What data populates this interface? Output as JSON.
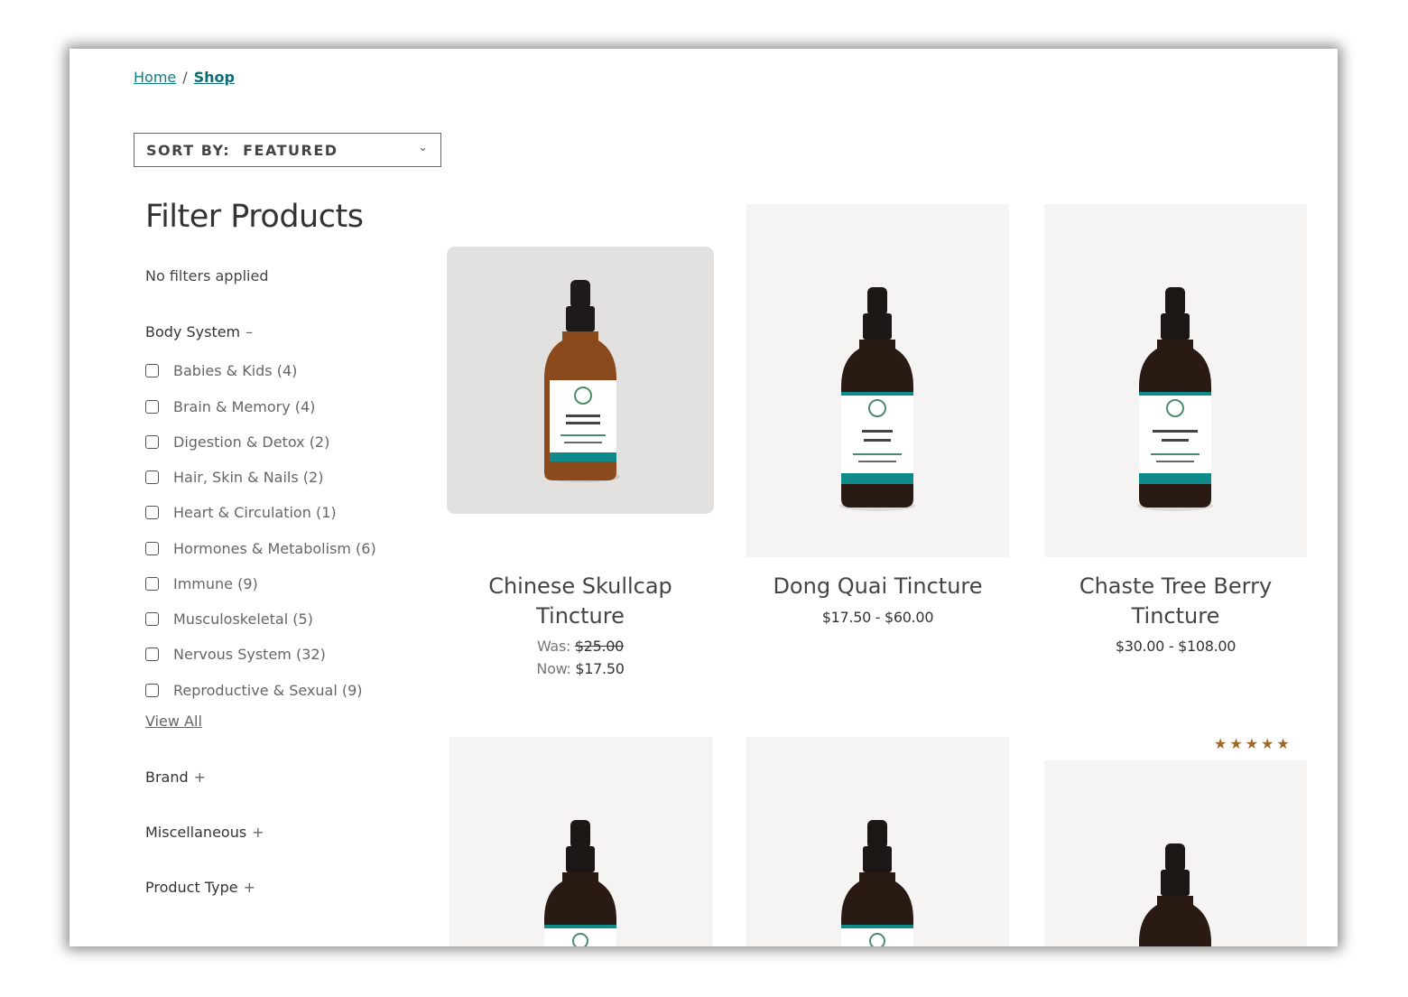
{
  "breadcrumb": {
    "home": "Home",
    "separator": "/",
    "current": "Shop"
  },
  "sort": {
    "label": "SORT BY:",
    "value": "FEATURED"
  },
  "filters": {
    "title": "Filter Products",
    "status": "No filters applied",
    "body_system": {
      "heading": "Body System",
      "toggle": "–",
      "items": [
        "Babies & Kids (4)",
        "Brain & Memory (4)",
        "Digestion & Detox (2)",
        "Hair, Skin & Nails (2)",
        "Heart & Circulation (1)",
        "Hormones & Metabolism (6)",
        "Immune (9)",
        "Musculoskeletal (5)",
        "Nervous System (32)",
        "Reproductive & Sexual (9)"
      ],
      "view_all": "View All"
    },
    "brand": {
      "heading": "Brand",
      "toggle": "+"
    },
    "misc": {
      "heading": "Miscellaneous",
      "toggle": "+"
    },
    "product_type": {
      "heading": "Product Type",
      "toggle": "+"
    }
  },
  "products": [
    {
      "title_line1": "Chinese Skullcap",
      "title_line2": "Tincture",
      "was_label": "Was:",
      "was_price": "$25.00",
      "now_label": "Now:",
      "now_price": "$17.50"
    },
    {
      "title_line1": "Dong Quai Tincture",
      "price": "$17.50 - $60.00"
    },
    {
      "title_line1": "Chaste Tree Berry",
      "title_line2": "Tincture",
      "price": "$30.00 - $108.00"
    }
  ],
  "rating": {
    "stars": "★★★★★",
    "value": 5,
    "max": 5
  },
  "colors": {
    "accent": "#0f7f86",
    "teal_label": "#0f8a8a",
    "star": "#a0672a",
    "card_bg": "#f6f4f3"
  },
  "icons": {
    "sort_chevron": "chevron-down-icon",
    "checkbox": "checkbox-icon",
    "star": "star-icon"
  }
}
